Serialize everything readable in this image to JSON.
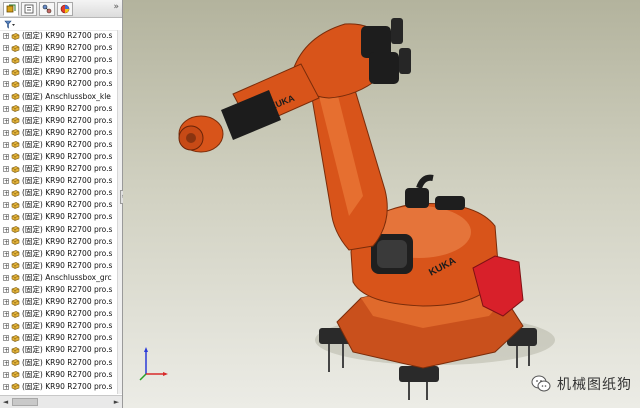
{
  "tree": {
    "tabs": [
      {
        "icon": "feature-manager-icon"
      },
      {
        "icon": "property-manager-icon"
      },
      {
        "icon": "configuration-manager-icon"
      },
      {
        "icon": "display-manager-icon"
      }
    ],
    "collapse_glyph": "»",
    "filter_icon": "filter-icon",
    "items": [
      {
        "label": "(固定) KR90 R2700 pro.s"
      },
      {
        "label": "(固定) KR90 R2700 pro.s"
      },
      {
        "label": "(固定) KR90 R2700 pro.s"
      },
      {
        "label": "(固定) KR90 R2700 pro.s"
      },
      {
        "label": "(固定) KR90 R2700 pro.s"
      },
      {
        "label": "(固定) Anschlussbox_kle"
      },
      {
        "label": "(固定) KR90 R2700 pro.s"
      },
      {
        "label": "(固定) KR90 R2700 pro.s"
      },
      {
        "label": "(固定) KR90 R2700 pro.s"
      },
      {
        "label": "(固定) KR90 R2700 pro.s"
      },
      {
        "label": "(固定) KR90 R2700 pro.s"
      },
      {
        "label": "(固定) KR90 R2700 pro.s"
      },
      {
        "label": "(固定) KR90 R2700 pro.s"
      },
      {
        "label": "(固定) KR90 R2700 pro.s"
      },
      {
        "label": "(固定) KR90 R2700 pro.s"
      },
      {
        "label": "(固定) KR90 R2700 pro.s"
      },
      {
        "label": "(固定) KR90 R2700 pro.s"
      },
      {
        "label": "(固定) KR90 R2700 pro.s"
      },
      {
        "label": "(固定) KR90 R2700 pro.s"
      },
      {
        "label": "(固定) KR90 R2700 pro.s"
      },
      {
        "label": "(固定) Anschlussbox_grc"
      },
      {
        "label": "(固定) KR90 R2700 pro.s"
      },
      {
        "label": "(固定) KR90 R2700 pro.s"
      },
      {
        "label": "(固定) KR90 R2700 pro.s"
      },
      {
        "label": "(固定) KR90 R2700 pro.s"
      },
      {
        "label": "(固定) KR90 R2700 pro.s"
      },
      {
        "label": "(固定) KR90 R2700 pro.s"
      },
      {
        "label": "(固定) KR90 R2700 pro.s"
      },
      {
        "label": "(固定) KR90 R2700 pro.s"
      },
      {
        "label": "(固定) KR90 R2700 pro.s"
      },
      {
        "label": "(固定) KR90 R2700 pro.s"
      },
      {
        "label": "(固定) KR90 R2700 pro.s"
      }
    ]
  },
  "viewport": {
    "model_brand_text": "KUKA",
    "colors": {
      "robot_orange": "#d8541a",
      "robot_dark": "#1b1b1b",
      "accent_red": "#d8202a"
    },
    "triad_icon": "coordinate-triad-icon"
  },
  "watermark": {
    "icon": "wechat-icon",
    "text": "机械图纸狗"
  }
}
